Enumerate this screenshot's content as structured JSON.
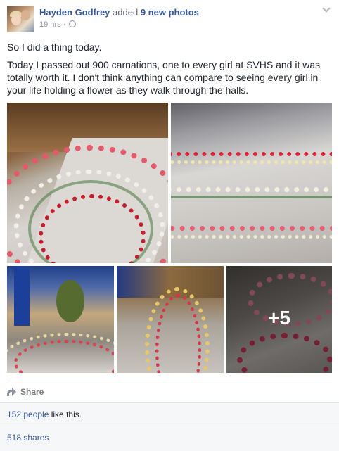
{
  "post": {
    "author_name": "Hayden Godfrey",
    "action_verb": "added",
    "action_count": "9 new photos",
    "action_suffix": ".",
    "timestamp": "19 hrs",
    "separator": "·",
    "privacy_icon": "globe-icon",
    "text_line1": "So I did a thing today.",
    "text_line2": "Today I passed out 900 carnations, one to every girl at SVHS and it was totally worth it. I don't think anything can compare to seeing every girl in your life holding a flower as they walk through the halls.",
    "more_photos_label": "+5"
  },
  "actions": {
    "share_label": "Share",
    "share_icon": "share-arrow-icon"
  },
  "ufi": {
    "likes_link": "152 people",
    "likes_text": " like this.",
    "shares_link": "518 shares"
  },
  "colors": {
    "link": "#365899",
    "meta": "#90949c",
    "ufi_bg": "#f6f7f9"
  }
}
